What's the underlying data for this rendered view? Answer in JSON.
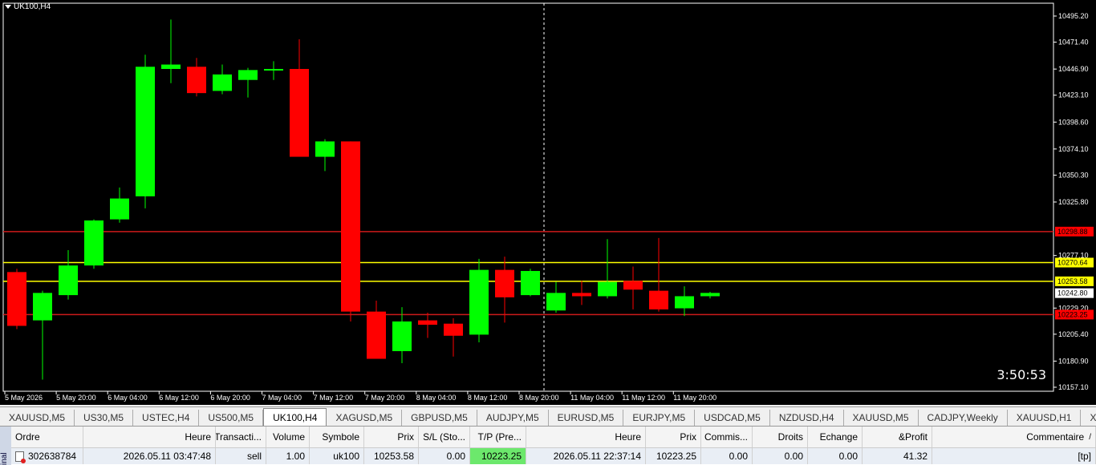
{
  "window": {
    "title": "UK100,H4",
    "timer": "3:50:53"
  },
  "chart_data": {
    "type": "candlestick",
    "symbol": "UK100,H4",
    "ylim": [
      10157.1,
      10507.5
    ],
    "price_labels": [
      "10495.20",
      "10471.40",
      "10446.90",
      "10423.10",
      "10398.60",
      "10374.10",
      "10350.30",
      "10325.80",
      "10277.10",
      "10229.20",
      "10205.40",
      "10180.90",
      "10157.10"
    ],
    "time_labels": [
      "5 May 2026",
      "5 May 20:00",
      "6 May 04:00",
      "6 May 12:00",
      "6 May 20:00",
      "7 May 04:00",
      "7 May 12:00",
      "7 May 20:00",
      "8 May 04:00",
      "8 May 12:00",
      "8 May 20:00",
      "11 May 04:00",
      "11 May 12:00",
      "11 May 20:00"
    ],
    "levels": [
      {
        "price": 10298.88,
        "label": "10298.88",
        "color": "#ff0000",
        "line": "#cc1a1a"
      },
      {
        "price": 10270.64,
        "label": "10270.64",
        "color": "#ffff00",
        "line": "#ffff00"
      },
      {
        "price": 10253.58,
        "label": "10253.58",
        "color": "#ffff00",
        "line": "#ffff00"
      },
      {
        "price": 10242.8,
        "label": "10242.80",
        "color": "#ffffff",
        "line": null
      },
      {
        "price": 10223.25,
        "label": "10223.25",
        "color": "#ff0000",
        "line": "#cc1a1a"
      }
    ],
    "candles": [
      {
        "o": 10262,
        "h": 10265,
        "l": 10210,
        "c": 10213
      },
      {
        "o": 10218,
        "h": 10245,
        "l": 10164,
        "c": 10243
      },
      {
        "o": 10241,
        "h": 10282,
        "l": 10237,
        "c": 10268
      },
      {
        "o": 10268,
        "h": 10310,
        "l": 10265,
        "c": 10309
      },
      {
        "o": 10310,
        "h": 10339,
        "l": 10307,
        "c": 10329
      },
      {
        "o": 10331,
        "h": 10460,
        "l": 10320,
        "c": 10449
      },
      {
        "o": 10447,
        "h": 10492,
        "l": 10434,
        "c": 10451
      },
      {
        "o": 10449,
        "h": 10457,
        "l": 10422,
        "c": 10425
      },
      {
        "o": 10427,
        "h": 10451,
        "l": 10424,
        "c": 10442
      },
      {
        "o": 10437,
        "h": 10448,
        "l": 10421,
        "c": 10446
      },
      {
        "o": 10447,
        "h": 10454,
        "l": 10437,
        "c": 10447
      },
      {
        "o": 10447,
        "h": 10474,
        "l": 10367,
        "c": 10367
      },
      {
        "o": 10367,
        "h": 10383,
        "l": 10354,
        "c": 10381
      },
      {
        "o": 10381,
        "h": 10381,
        "l": 10217,
        "c": 10226
      },
      {
        "o": 10226,
        "h": 10236,
        "l": 10186,
        "c": 10183
      },
      {
        "o": 10190,
        "h": 10230,
        "l": 10179,
        "c": 10217
      },
      {
        "o": 10218,
        "h": 10225,
        "l": 10202,
        "c": 10214
      },
      {
        "o": 10215,
        "h": 10220,
        "l": 10185,
        "c": 10204
      },
      {
        "o": 10205,
        "h": 10274,
        "l": 10198,
        "c": 10264
      },
      {
        "o": 10264,
        "h": 10276,
        "l": 10216,
        "c": 10239
      },
      {
        "o": 10241,
        "h": 10265,
        "l": 10240,
        "c": 10263
      },
      {
        "o": 10227,
        "h": 10253,
        "l": 10225,
        "c": 10243
      },
      {
        "o": 10243,
        "h": 10254,
        "l": 10232,
        "c": 10240
      },
      {
        "o": 10240,
        "h": 10292,
        "l": 10238,
        "c": 10253
      },
      {
        "o": 10254,
        "h": 10267,
        "l": 10228,
        "c": 10246
      },
      {
        "o": 10245,
        "h": 10293,
        "l": 10226,
        "c": 10228
      },
      {
        "o": 10229,
        "h": 10249,
        "l": 10222,
        "c": 10240
      },
      {
        "o": 10240,
        "h": 10244,
        "l": 10238,
        "c": 10243
      }
    ],
    "colors": {
      "bull": "#00ff00",
      "bear": "#ff0000",
      "background": "#000000",
      "axis": "#ffffff"
    },
    "grid": false
  },
  "tabs": [
    {
      "label": "XAUUSD,M5",
      "active": false
    },
    {
      "label": "US30,M5",
      "active": false
    },
    {
      "label": "USTEC,H4",
      "active": false
    },
    {
      "label": "US500,M5",
      "active": false
    },
    {
      "label": "UK100,H4",
      "active": true
    },
    {
      "label": "XAGUSD,M5",
      "active": false
    },
    {
      "label": "GBPUSD,M5",
      "active": false
    },
    {
      "label": "AUDJPY,M5",
      "active": false
    },
    {
      "label": "EURUSD,M5",
      "active": false
    },
    {
      "label": "EURJPY,M5",
      "active": false
    },
    {
      "label": "USDCAD,M5",
      "active": false
    },
    {
      "label": "NZDUSD,H4",
      "active": false
    },
    {
      "label": "XAUUSD,M5",
      "active": false
    },
    {
      "label": "CADJPY,Weekly",
      "active": false
    },
    {
      "label": "XAUUSD,H1",
      "active": false
    },
    {
      "label": "XAUUSD,W",
      "active": false
    }
  ],
  "terminal": {
    "side_label": "inal",
    "headers": [
      "Ordre",
      "Heure",
      "Transacti...",
      "Volume",
      "Symbole",
      "Prix",
      "S/L (Sto...",
      "T/P (Pre...",
      "Heure",
      "Prix",
      "Commis...",
      "Droits",
      "Echange",
      "&Profit",
      "Commentaire"
    ],
    "sort_arrow": "/",
    "rows": [
      [
        "302638784",
        "2026.05.11 03:47:48",
        "sell",
        "1.00",
        "uk100",
        "10253.58",
        "0.00",
        "10223.25",
        "2026.05.11 22:37:14",
        "10223.25",
        "0.00",
        "0.00",
        "0.00",
        "41.32",
        "[tp]"
      ]
    ]
  }
}
